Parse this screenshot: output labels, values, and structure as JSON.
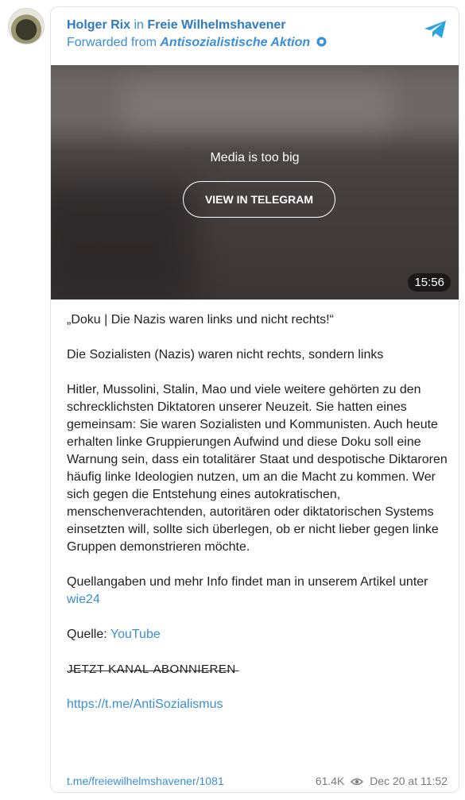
{
  "header": {
    "author": "Holger Rix",
    "in_word": " in ",
    "channel": "Freie Wilhelmshavener",
    "forwarded_prefix": "Forwarded from ",
    "forwarded_source": "Antisozialistische Aktion"
  },
  "media": {
    "message": "Media is too big",
    "button": "VIEW IN TELEGRAM",
    "duration": "15:56"
  },
  "post": {
    "title": "„Doku | Die Nazis waren links und nicht rechts!“",
    "subtitle": "Die Sozialisten (Nazis) waren nicht rechts, sondern links",
    "body": "Hitler, Mussolini, Stalin, Mao und viele weitere gehörten zu den schrecklichsten Diktatoren unserer Neuzeit. Sie hatten eines gemeinsam: Sie waren Sozialisten und Kommunisten. Auch heute erhalten linke Gruppierungen Aufwind und diese Doku soll eine Warnung sein, dass ein totalitärer Staat und despotische Diktaroren häufig linke Ideologien nutzen, um an die Macht zu kommen. Wer sich gegen die Entstehung eines autokratischen, menschenverachtenden, autoritären oder diktatorischen Systems einsetzten will, sollte sich überlegen, ob er nicht lieber gegen linke Gruppen demonstrieren möchte.",
    "sources_text": "Quellangaben und mehr Info findet man in unserem Artikel unter ",
    "sources_link": "wie24",
    "quelle_label": "Quelle: ",
    "quelle_link": "YouTube",
    "subscribe": "J̶E̶T̶Z̶T̶ ̶K̶A̶N̶A̶L̶ ̶A̶B̶O̶N̶N̶I̶E̶R̶E̶N̶",
    "channel_link": "https://t.me/AntiSozialismus"
  },
  "footer": {
    "post_link": "t.me/freiewilhelmshavener/1081",
    "views": "61.4K",
    "date": "Dec 20 at 11:52"
  },
  "colors": {
    "link": "#3a8fd6",
    "author": "#2f7bc0",
    "telegram": "#2aa3df"
  }
}
